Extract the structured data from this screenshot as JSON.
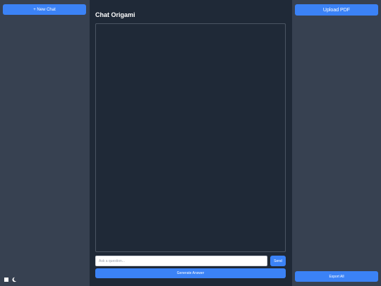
{
  "sidebar_left": {
    "new_chat_label": "+ New Chat"
  },
  "header": {
    "title": "Chat Origami"
  },
  "composer": {
    "placeholder": "Ask a question...",
    "send_label": "Send",
    "generate_label": "Generate Answer"
  },
  "sidebar_right": {
    "upload_label": "Upload PDF",
    "export_label": "Export All"
  },
  "icons": {
    "theme_light": "square-icon",
    "theme_dark": "moon-icon"
  },
  "colors": {
    "accent": "#3b82f6",
    "sidebar_bg": "#374151",
    "main_bg": "#1f2937"
  }
}
